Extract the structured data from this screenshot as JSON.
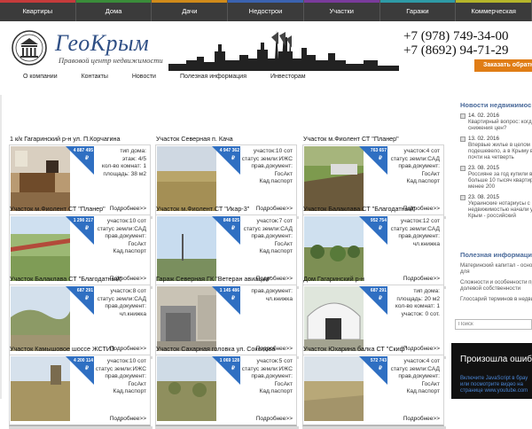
{
  "topnav": [
    {
      "label": "Квартиры",
      "color": "#c53b3b"
    },
    {
      "label": "Дома",
      "color": "#3a8c3a"
    },
    {
      "label": "Дачи",
      "color": "#d08a1a"
    },
    {
      "label": "Недострои",
      "color": "#3b63b0"
    },
    {
      "label": "Участки",
      "color": "#7a3b9c"
    },
    {
      "label": "Гаражи",
      "color": "#2e9aa6"
    },
    {
      "label": "Коммерческая",
      "color": "#b5b52a"
    }
  ],
  "header": {
    "brand": "ГеоКрым",
    "tagline": "Правовой центр недвижимости",
    "seal_text": "ГеоКрым",
    "phone1": "+7 (978) 749-34-00",
    "phone2": "+7 (8692) 94-71-29",
    "callback": "Заказать обратн"
  },
  "secnav": [
    "О компании",
    "Контакты",
    "Новости",
    "Полезная информация",
    "Инвесторам"
  ],
  "listings": [
    {
      "title": "1 к/к Гагаринский р-н ул. П.Корчагина",
      "price": "4 887 495",
      "currency": "₽",
      "lines": [
        "тип дома:",
        "этаж: 4/5",
        "кол-во комнат: 1",
        "площадь: 38 м2"
      ],
      "more": "Подробнее>>",
      "photo": "interior",
      "line_color": "#d9d9d9"
    },
    {
      "title": "Участок Северная п. Кача",
      "price": "4 947 362",
      "currency": "₽",
      "lines": [
        "участок:10 сот",
        "статус земли:ИЖС",
        "прав.документ:",
        "ГосАкт",
        "Кад.паспорт"
      ],
      "more": "Подробнее>>",
      "photo": "steppe",
      "line_color": "#d9d9d9"
    },
    {
      "title": "Участок м.Фиолент СТ \"Планер\"",
      "price": "763 657",
      "currency": "₽",
      "lines": [
        "участок:4 сот",
        "статус земли:САД",
        "прав.документ:",
        "ГосАкт",
        "Кад.паспорт"
      ],
      "more": "Подробнее>>",
      "photo": "garden",
      "line_color": "#d9d9d9"
    },
    {
      "title": "Участок м.Фиолент СТ \"Планер\"",
      "price": "1 290 217",
      "currency": "₽",
      "lines": [
        "участок:10 сот",
        "статус земли:САД",
        "прав.документ:",
        "ГосАкт",
        "Кад.паспорт"
      ],
      "more": "Подробнее>>",
      "photo": "fence",
      "line_color": "#d9d9d9"
    },
    {
      "title": "Участок м.Фиолент СТ \"Икар-3\"",
      "price": "848 025",
      "currency": "₽",
      "lines": [
        "участок:7 сот",
        "статус земли:САД",
        "прав.документ:",
        "ГосАкт",
        "Кад.паспорт"
      ],
      "more": "Подробнее>>",
      "photo": "sky",
      "line_color": "#d9d9d9"
    },
    {
      "title": "Участок Балаклава СТ \"Благодатный\"",
      "price": "952 754",
      "currency": "₽",
      "lines": [
        "участок:12 сот",
        "статус земли:САД",
        "прав.документ:",
        "чл.книжка"
      ],
      "more": "Подробнее>>",
      "photo": "trees",
      "line_color": "#d9d9d9"
    },
    {
      "title": "Участок Балаклава СТ \"Благодатный\"",
      "price": "687 291",
      "currency": "₽",
      "lines": [
        "участок:8 сот",
        "статус земли:САД",
        "прав.документ:",
        "чл.книжка"
      ],
      "more": "Подробнее>>",
      "photo": "hills",
      "line_color": "#d9d9d9"
    },
    {
      "title": "Гараж Северная ГК \"Ветеран авиации\"",
      "price": "1 145 486",
      "currency": "₽",
      "lines": [
        "прав.документ:",
        "чл.книжка"
      ],
      "more": "Подробнее>>",
      "photo": "garage",
      "line_color": "#d9d9d9"
    },
    {
      "title": "Дом Гагаринский р-н",
      "price": "687 291",
      "currency": "₽",
      "lines": [
        "тип дома:",
        "площадь: 20 м2",
        "кол-во комнат: 1",
        "участок: 0 сот."
      ],
      "more": "Подробнее>>",
      "photo": "greenhouse",
      "line_color": "#d9d9d9"
    },
    {
      "title": "Участок Камышовое шоссе ЖСТИЗ",
      "price": "4 200 114",
      "currency": "₽",
      "lines": [
        "участок:10 сот",
        "статус земли:ИЖС",
        "прав.документ:",
        "ГосАкт",
        "Кад.паспорт"
      ],
      "more": "Подробнее>>",
      "photo": "field",
      "line_color": "#d9d9d9"
    },
    {
      "title": "Участок Сахарная головка ул. Соколова",
      "price": "1 069 128",
      "currency": "₽",
      "lines": [
        "участок:5 сот",
        "статус земли:ИЖС",
        "прав.документ:",
        "ГосАкт",
        "Кад.паспорт"
      ],
      "more": "Подробнее>>",
      "photo": "brush",
      "line_color": "#d9d9d9"
    },
    {
      "title": "Участок Юхарина балка СТ \"Скиф\"",
      "price": "572 743",
      "currency": "₽",
      "lines": [
        "участок:4 сот",
        "статус земли:САД",
        "прав.документ:",
        "ГосАкт",
        "Кад.паспорт"
      ],
      "more": "Подробнее>>",
      "photo": "dry",
      "line_color": "#d9d9d9"
    }
  ],
  "sidebar": {
    "news_title": "Новости недвижимос",
    "news": [
      {
        "date": "14. 02. 2016",
        "text": [
          "Квартирный вопрос: когда ж",
          "снижения цен?"
        ]
      },
      {
        "date": "13. 02. 2016",
        "text": [
          "Впервые жилье в целом по",
          "подешевело, а в Крыму выр",
          "почти на четверть"
        ]
      },
      {
        "date": "23. 08. 2015",
        "text": [
          "Россияне за год купили в Кр",
          "больше 10 тысяч квартир, у",
          "менее 200"
        ]
      },
      {
        "date": "23. 08. 2015",
        "text": [
          "Украинские нотариусы с 1 д",
          "недвижимостью начали укр",
          "Крым - российский"
        ]
      }
    ],
    "info_title": "Полезная информаци",
    "info": [
      [
        "Материнский капитал - основа",
        "для"
      ],
      [
        "Сложности и особенности прод",
        "долевой собственности"
      ],
      [
        "Глоссарий терминов в недвижи"
      ]
    ],
    "search_placeholder": "Поиск"
  },
  "video": {
    "title": "Произошла ошибка.",
    "subtitle": [
      "Включите JavaScript в брау",
      "или посмотрите видео на",
      "странице www.youtube.com"
    ]
  }
}
